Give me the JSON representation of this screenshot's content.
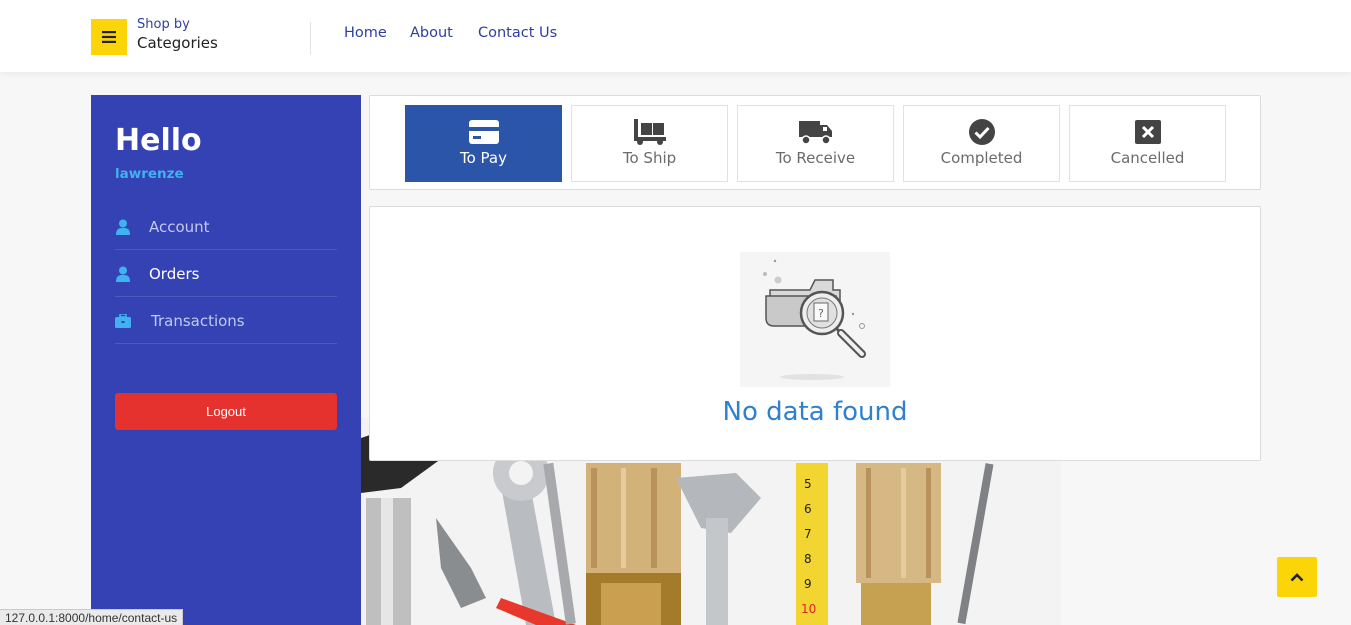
{
  "header": {
    "shop_by": "Shop by",
    "categories": "Categories",
    "nav": [
      {
        "label": "Home"
      },
      {
        "label": "About"
      },
      {
        "label": "Contact Us"
      }
    ]
  },
  "sidebar": {
    "greeting": "Hello",
    "username": "lawrenze",
    "items": [
      {
        "label": "Account",
        "icon": "user-icon"
      },
      {
        "label": "Orders",
        "icon": "user-icon"
      },
      {
        "label": "Transactions",
        "icon": "briefcase-icon"
      }
    ],
    "logout_label": "Logout"
  },
  "tabs": [
    {
      "label": "To Pay",
      "icon": "credit-card-icon",
      "active": true
    },
    {
      "label": "To Ship",
      "icon": "dolly-icon"
    },
    {
      "label": "To Receive",
      "icon": "truck-icon"
    },
    {
      "label": "Completed",
      "icon": "check-circle-icon"
    },
    {
      "label": "Cancelled",
      "icon": "x-square-icon"
    }
  ],
  "content": {
    "empty_message": "No data found"
  },
  "status_url": "127.0.0.1:8000/home/contact-us",
  "colors": {
    "accent_yellow": "#fcd509",
    "sidebar_blue": "#3442b4",
    "active_tab": "#2b55a8",
    "logout_red": "#e5322e",
    "username_blue": "#3fb2ef",
    "nodata_blue": "#2f80cf"
  }
}
